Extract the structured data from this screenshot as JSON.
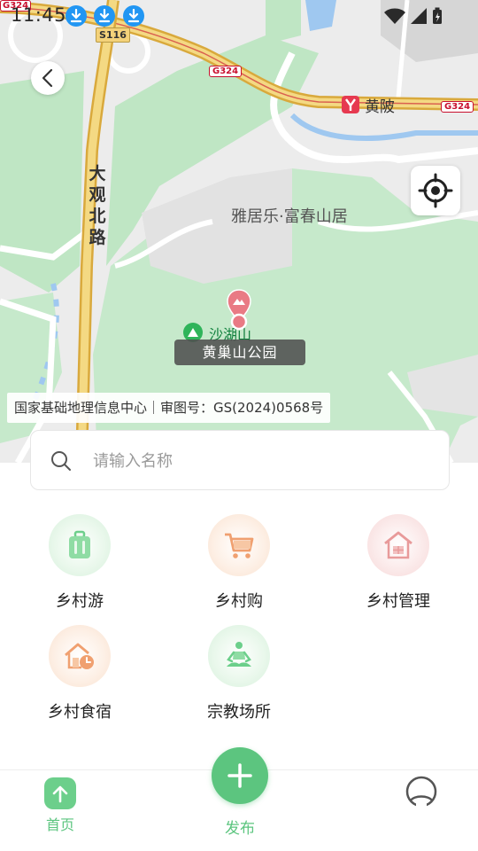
{
  "status_bar": {
    "time": "11:45"
  },
  "map": {
    "road_vertical": [
      "大",
      "观",
      "北",
      "路"
    ],
    "area_name": "雅居乐·富春山居",
    "town_name": "黄陂",
    "park_name": "沙湖山",
    "road_shield_s116": "S116",
    "road_shield_g324": "G324",
    "selected_poi": "黄巢山公园",
    "copyright": "国家基础地理信息中心｜审图号：GS(2024)0568号"
  },
  "search": {
    "placeholder": "请输入名称"
  },
  "features": [
    {
      "label": "乡村游",
      "icon": "luggage-icon",
      "color": "#6ccf8b"
    },
    {
      "label": "乡村购",
      "icon": "shopping-cart-icon",
      "color": "#f0a070"
    },
    {
      "label": "乡村管理",
      "icon": "house-grid-icon",
      "color": "#e89a9a"
    },
    {
      "label": "乡村食宿",
      "icon": "house-clock-icon",
      "color": "#f0a070"
    },
    {
      "label": "宗教场所",
      "icon": "meditation-icon",
      "color": "#6ccf8b"
    }
  ],
  "bottom_nav": {
    "home_label": "首页",
    "publish_label": "发布",
    "accent_color": "#5cc57f"
  }
}
